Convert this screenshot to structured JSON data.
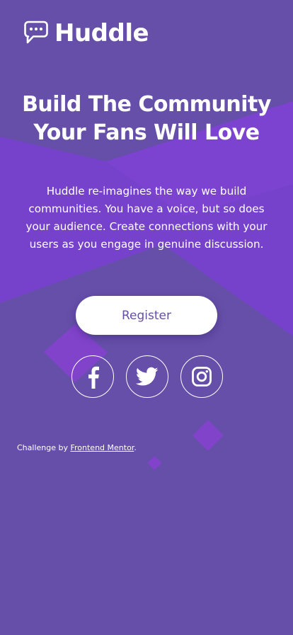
{
  "brand": {
    "name": "Huddle",
    "logo_icon": "speech-bubble-dots-icon"
  },
  "hero": {
    "title_line1": "Build The Community",
    "title_line2": "Your Fans Will Love",
    "description": "Huddle re-imagines the way we build communities. You have a voice, but so does your audience. Create connections with your users as you engage in genuine discussion.",
    "cta_label": "Register"
  },
  "social": [
    {
      "name": "facebook",
      "icon": "facebook-icon"
    },
    {
      "name": "twitter",
      "icon": "twitter-icon"
    },
    {
      "name": "instagram",
      "icon": "instagram-icon"
    }
  ],
  "attribution": {
    "prefix": "Challenge by ",
    "link_text": "Frontend Mentor",
    "suffix": "."
  },
  "colors": {
    "background": "#664fa9",
    "accent_shape": "#7b3fd0",
    "button_background": "#ffffff",
    "button_text": "#664fa9",
    "text": "#ffffff"
  }
}
